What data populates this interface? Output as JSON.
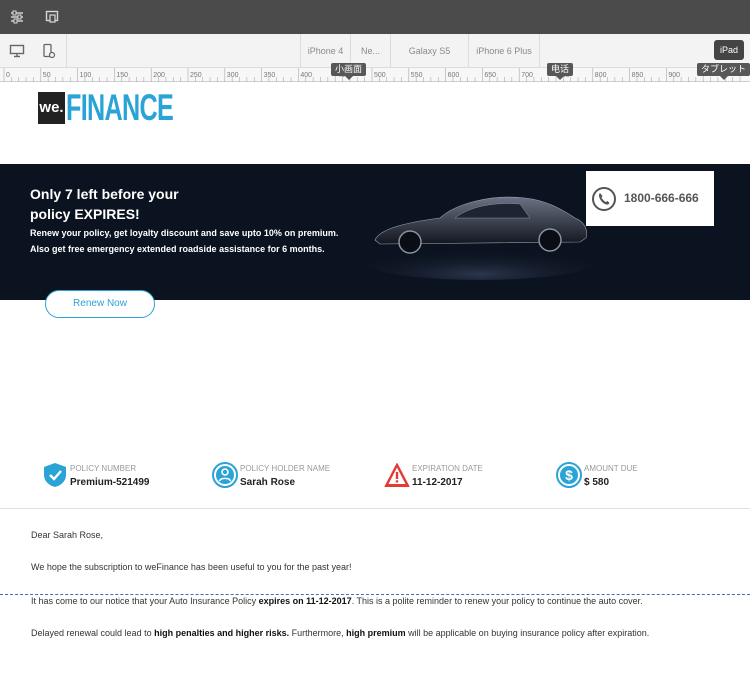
{
  "device_bar": {
    "segments": [
      "iPhone 4",
      "Ne...",
      "Galaxy S5",
      "iPhone 6 Plus"
    ],
    "ipad_label": "iPad"
  },
  "ruler": {
    "ticks": [
      "0",
      "50",
      "100",
      "150",
      "200",
      "250",
      "300",
      "350",
      "400",
      "450",
      "500",
      "550",
      "600",
      "650",
      "700",
      "750",
      "800",
      "850",
      "900"
    ],
    "tags": {
      "small_screen": "小画面",
      "phone": "电话",
      "tablet": "タブレット"
    }
  },
  "logo": {
    "we": "we.",
    "finance": "FINANCE"
  },
  "banner": {
    "heading": "Only 7 left before your policy EXPIRES!",
    "line1": "Renew your policy, get loyalty discount and save upto 10% on premium.",
    "line2": "Also get free emergency extended roadside assistance for 6 months.",
    "phone": "1800-666-666"
  },
  "renew_button": "Renew Now",
  "info": [
    {
      "label": "POLICY NUMBER",
      "value": "Premium-521499",
      "icon": "shield-icon"
    },
    {
      "label": "POLICY HOLDER NAME",
      "value": "Sarah Rose",
      "icon": "user-icon"
    },
    {
      "label": "EXPIRATION DATE",
      "value": "11-12-2017",
      "icon": "warning-icon"
    },
    {
      "label": "AMOUNT DUE",
      "value": "$ 580",
      "icon": "dollar-icon"
    }
  ],
  "letter": {
    "greeting": "Dear Sarah Rose,",
    "p1": "We hope the subscription to weFinance has been useful to you for the past year!",
    "p2a": "It has come to our notice that your Auto Insurance Policy ",
    "p2b": "expires on 11-12-2017",
    "p2c": ". This is a polite reminder to renew your policy to continue the auto cover.",
    "p3a": "Delayed renewal could lead to ",
    "p3b": "high penalties and higher risks.",
    "p3c": " Furthermore, ",
    "p3d": "high premium",
    "p3e": " will be applicable on buying insurance policy after expiration."
  },
  "colors": {
    "accent": "#2aa3d6",
    "banner_bg": "#0c1320",
    "warning": "#e53935"
  }
}
